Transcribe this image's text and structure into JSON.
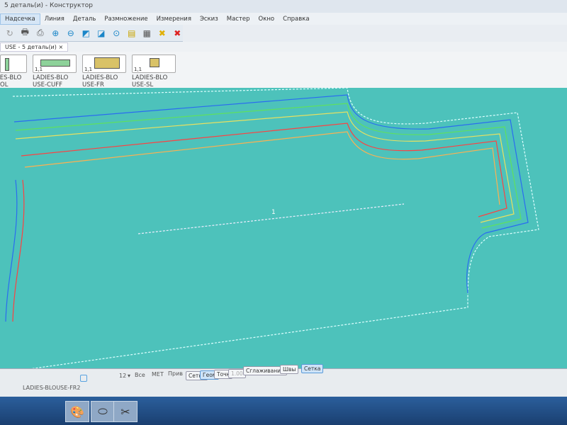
{
  "window": {
    "title": "5 деталь(и) - Конструктор"
  },
  "menu": [
    "Надсечка",
    "Линия",
    "Деталь",
    "Размножение",
    "Измерения",
    "Эскиз",
    "Мастер",
    "Окно",
    "Справка"
  ],
  "menu_active": "Надсечка",
  "toolbar": {
    "icons": [
      "redo-icon",
      "plotter-icon",
      "print-icon",
      "zoom-in-icon",
      "zoom-out-icon",
      "zoom-piece-icon",
      "zoom-all-icon",
      "zoom-1-1-icon",
      "layout-icon",
      "report-icon",
      "delete-yellow-icon",
      "delete-red-icon"
    ]
  },
  "tab": {
    "label": "USE - 5 деталь(и)",
    "close": "×"
  },
  "pieces": [
    {
      "name1": "LADIES-BLO",
      "name2": "OL",
      "scale": ""
    },
    {
      "name1": "LADIES-BLO",
      "name2": "USE-CUFF",
      "scale": "1,1"
    },
    {
      "name1": "LADIES-BLO",
      "name2": "USE-FR",
      "scale": "1,1"
    },
    {
      "name1": "LADIES-BLO",
      "name2": "USE-SL",
      "scale": "1,1"
    }
  ],
  "canvas": {
    "background": "#4dc2bb",
    "notch_label": "1"
  },
  "status": {
    "piece_name": "LADIES-BLOUSE-FR2",
    "size_value": "12",
    "size_all": "Все",
    "units": "МЕТ",
    "snap": "Прив",
    "buttons": [
      "Сетка",
      "Геом",
      "Точк",
      "1.00",
      "Сглаживание",
      "Швы",
      "Сетка"
    ],
    "active_button": "Геом"
  }
}
